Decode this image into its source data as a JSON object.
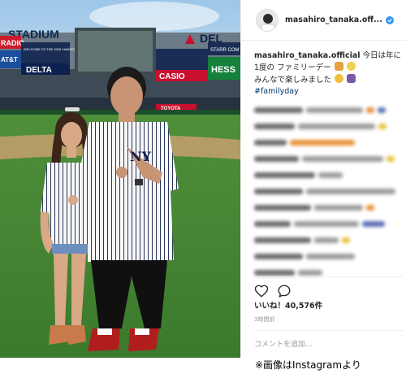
{
  "post": {
    "username": "masahiro_tanaka.off...",
    "caption_user": "masahiro_tanaka.official",
    "caption_text": "今日は年に1度の ファミリーデー",
    "caption_text2": "みんなで楽しみました",
    "hashtag": "#familyday",
    "likes": "いいね！40,576件",
    "time": "3時間前",
    "comment_placeholder": "コメントを追加...",
    "icons": [
      "verified-badge",
      "heart-icon",
      "comment-icon"
    ]
  },
  "photo": {
    "signs": {
      "stadium": "STADIUM",
      "radio": "RADIO",
      "att": "AT&T",
      "delta": "DELTA",
      "welcome": "WELCOME TO THE 2018 YANKEES TEAM PICNIC",
      "casio": "CASIO",
      "hess": "HESS",
      "delta2": "DEL",
      "starr": "STARR COM",
      "toyota": "TOYOTA",
      "jersey": "NY"
    }
  },
  "credit": "※画像はInstagramより",
  "colors": {
    "link": "#003569",
    "muted": "#999999",
    "verified": "#3897f0",
    "border": "#efefef"
  }
}
